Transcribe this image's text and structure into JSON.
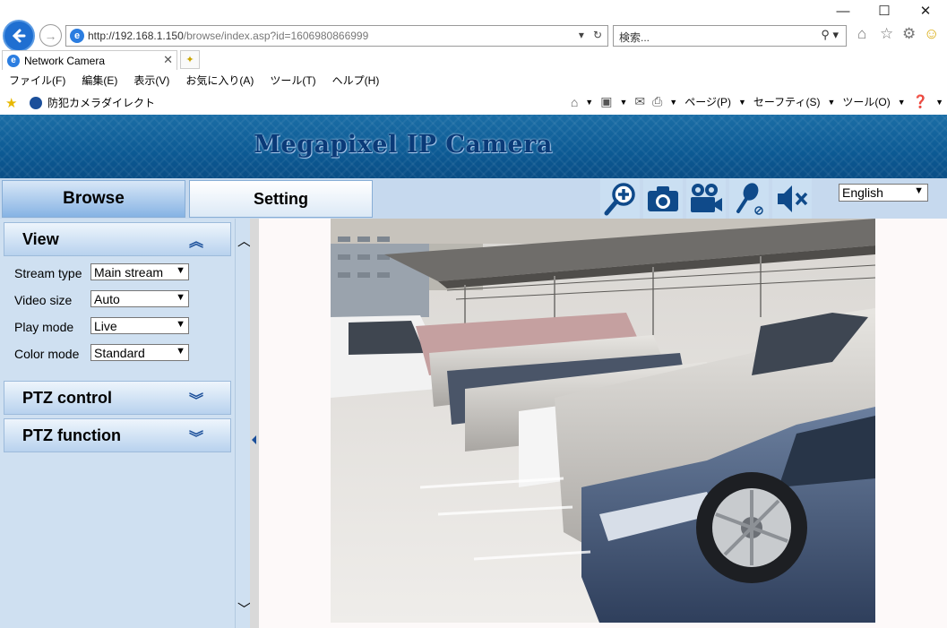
{
  "browser": {
    "url_prefix": "http://192.168.1.150",
    "url_rest": "/browse/index.asp?id=1606980866999",
    "search_placeholder": "検索...",
    "tab_title": "Network Camera",
    "menu": [
      "ファイル(F)",
      "編集(E)",
      "表示(V)",
      "お気に入り(A)",
      "ツール(T)",
      "ヘルプ(H)"
    ],
    "favorite_link": "防犯カメラダイレクト",
    "command_bar": [
      "ページ(P)",
      "セーフティ(S)",
      "ツール(O)"
    ]
  },
  "page": {
    "banner_title": "Megapixel IP Camera",
    "tabs": {
      "browse": "Browse",
      "setting": "Setting"
    },
    "language": "English",
    "colors": {
      "accent": "#1b4f9a",
      "banner": "#0c5a94",
      "panel": "#cfe0f1"
    }
  },
  "sidebar": {
    "view": {
      "title": "View",
      "fields": [
        {
          "label": "Stream type",
          "value": "Main stream"
        },
        {
          "label": "Video size",
          "value": "Auto"
        },
        {
          "label": "Play mode",
          "value": "Live"
        },
        {
          "label": "Color mode",
          "value": "Standard"
        }
      ]
    },
    "ptz_control": "PTZ control",
    "ptz_function": "PTZ function"
  },
  "toolbar_icons": [
    "zoom-in-icon",
    "camera-icon",
    "video-record-icon",
    "microphone-icon",
    "speaker-mute-icon"
  ]
}
